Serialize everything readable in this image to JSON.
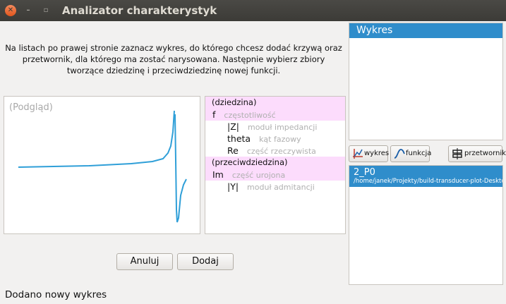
{
  "window": {
    "title": "Analizator charakterystyk"
  },
  "instructions": [
    "Na listach po prawej stronie zaznacz wykres, do którego chcesz dodać krzywą oraz",
    "przetwornik, dla którego ma zostać narysowana. Następnie wybierz zbiory",
    "tworzące dziedzinę i przeciwdziedzinę nowej funkcji."
  ],
  "preview": {
    "label": "(Podgląd)",
    "curve_color": "#2f9fd8"
  },
  "fields": {
    "domain_header": "(dziedzina)",
    "domain": [
      {
        "symbol": "f",
        "desc": "częstotliwość"
      }
    ],
    "sub_items": [
      {
        "symbol": "|Z|",
        "desc": "moduł impedancji"
      },
      {
        "symbol": "theta",
        "desc": "kąt fazowy"
      },
      {
        "symbol": "Re",
        "desc": "część rzeczywista"
      }
    ],
    "codomain_header": "(przeciwdziedzina)",
    "codomain": [
      {
        "symbol": "Im",
        "desc": "część urojona"
      }
    ],
    "codomain_sub": [
      {
        "symbol": "|Y|",
        "desc": "moduł admitancji"
      }
    ]
  },
  "buttons": {
    "cancel": "Anuluj",
    "add": "Dodaj"
  },
  "status": "Dodano nowy wykres",
  "plots_list": {
    "header": "Wykres"
  },
  "toolbar": {
    "plot": "wykres",
    "function": "funkcja",
    "transducer": "przetwornik"
  },
  "transducers": [
    {
      "name": "2_P0",
      "path": "/home/janek/Projekty/build-transducer-plot-Deskto"
    }
  ],
  "colors": {
    "accent": "#2f8dcb",
    "highlight": "#fcdcfc"
  }
}
